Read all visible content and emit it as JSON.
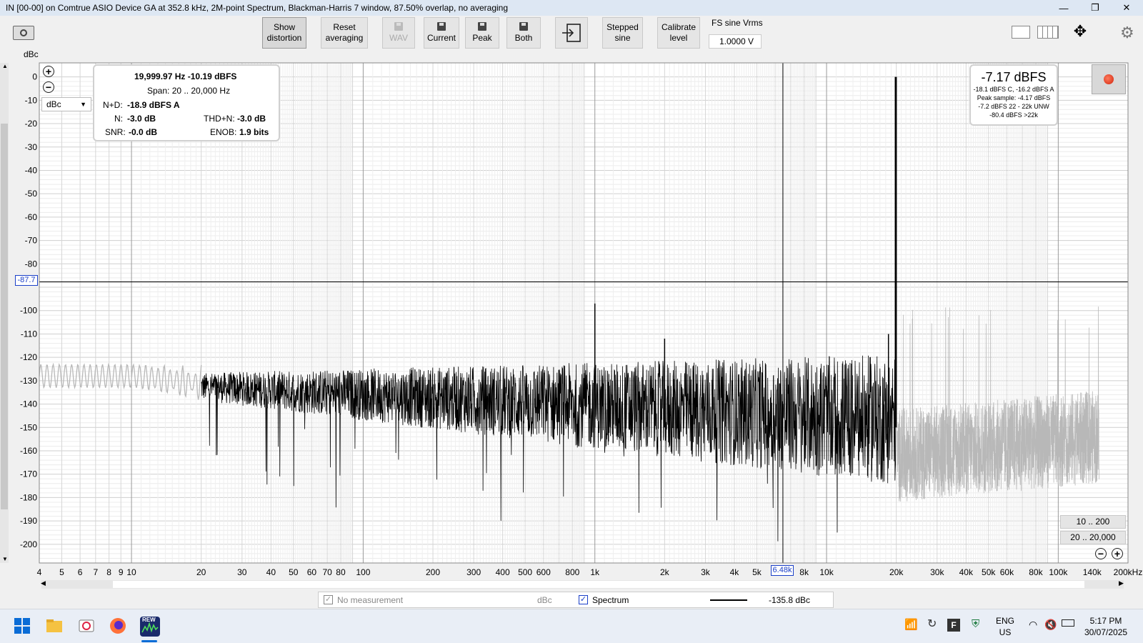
{
  "window": {
    "title": "IN [00-00] on Comtrue ASIO Device GA at 352.8 kHz, 2M-point Spectrum, Blackman-Harris 7 window, 87.50% overlap, no averaging",
    "minimize": "—",
    "maximize": "❐",
    "close": "✕"
  },
  "toolbar": {
    "show_distortion": [
      "Show",
      "distortion"
    ],
    "reset_averaging": [
      "Reset",
      "averaging"
    ],
    "wav": "WAV",
    "current": "Current",
    "peak": "Peak",
    "both": "Both",
    "stepped_sine": [
      "Stepped",
      "sine"
    ],
    "calibrate_level": [
      "Calibrate",
      "level"
    ],
    "fs_sine_label": "FS sine Vrms",
    "fs_sine_value": "1.0000 V"
  },
  "info_box": {
    "freq_level": "19,999.97 Hz  -10.19 dBFS",
    "span": "Span: 20 .. 20,000 Hz",
    "nd_label": "N+D:",
    "nd_value": "-18.9 dBFS A",
    "n_label": "N:",
    "n_value": "-3.0 dB",
    "thdn_label": "THD+N:",
    "thdn_value": "-3.0 dB",
    "snr_label": "SNR:",
    "snr_value": "-0.0 dB",
    "enob_label": "ENOB:",
    "enob_value": "1.9 bits"
  },
  "level_box": {
    "main": "-7.17 dBFS",
    "lines": [
      "-18.1 dBFS C, -16.2 dBFS A",
      "Peak sample: -4.17 dBFS",
      "-7.2 dBFS 22 - 22k UNW",
      "-80.4 dBFS >22k"
    ]
  },
  "plot": {
    "y_unit": "dBc",
    "unit_select": "dBc",
    "cursor_y": "-87.7",
    "cursor_x": "6.48k",
    "range_btn_1": "10 .. 200",
    "range_btn_2": "20 .. 20,000"
  },
  "chart_data": {
    "type": "line",
    "ylabel": "dBc",
    "xlabel": "",
    "x_scale": "log",
    "xlim_hz": [
      4,
      200000
    ],
    "ylim": [
      -208,
      6
    ],
    "y_ticks": [
      "0",
      "-10",
      "-20",
      "-30",
      "-40",
      "-50",
      "-60",
      "-70",
      "-80",
      "-90",
      "-100",
      "-110",
      "-120",
      "-130",
      "-140",
      "-150",
      "-160",
      "-170",
      "-180",
      "-190",
      "-200"
    ],
    "x_ticks": [
      {
        "hz": 4,
        "label": "4"
      },
      {
        "hz": 5,
        "label": "5"
      },
      {
        "hz": 6,
        "label": "6"
      },
      {
        "hz": 7,
        "label": "7"
      },
      {
        "hz": 8,
        "label": "8"
      },
      {
        "hz": 9,
        "label": "9"
      },
      {
        "hz": 10,
        "label": "10"
      },
      {
        "hz": 20,
        "label": "20"
      },
      {
        "hz": 30,
        "label": "30"
      },
      {
        "hz": 40,
        "label": "40"
      },
      {
        "hz": 50,
        "label": "50"
      },
      {
        "hz": 60,
        "label": "60"
      },
      {
        "hz": 70,
        "label": "70"
      },
      {
        "hz": 80,
        "label": "80"
      },
      {
        "hz": 100,
        "label": "100"
      },
      {
        "hz": 200,
        "label": "200"
      },
      {
        "hz": 300,
        "label": "300"
      },
      {
        "hz": 400,
        "label": "400"
      },
      {
        "hz": 500,
        "label": "500"
      },
      {
        "hz": 600,
        "label": "600"
      },
      {
        "hz": 800,
        "label": "800"
      },
      {
        "hz": 1000,
        "label": "1k"
      },
      {
        "hz": 2000,
        "label": "2k"
      },
      {
        "hz": 3000,
        "label": "3k"
      },
      {
        "hz": 4000,
        "label": "4k"
      },
      {
        "hz": 5000,
        "label": "5k"
      },
      {
        "hz": 8000,
        "label": "8k"
      },
      {
        "hz": 10000,
        "label": "10k"
      },
      {
        "hz": 20000,
        "label": "20k"
      },
      {
        "hz": 30000,
        "label": "30k"
      },
      {
        "hz": 40000,
        "label": "40k"
      },
      {
        "hz": 50000,
        "label": "50k"
      },
      {
        "hz": 60000,
        "label": "60k"
      },
      {
        "hz": 80000,
        "label": "80k"
      },
      {
        "hz": 100000,
        "label": "100k"
      },
      {
        "hz": 140000,
        "label": "140k"
      },
      {
        "hz": 200000,
        "label": "200kHz"
      }
    ],
    "cursor": {
      "x_hz": 6480,
      "y_db": -87.7
    },
    "series": [
      {
        "name": "Spectrum",
        "color": "#000000",
        "noise_floor_db": -140,
        "peaks": [
          {
            "hz": 1000,
            "db": -97
          },
          {
            "hz": 2000,
            "db": -112
          },
          {
            "hz": 19800,
            "db": 0
          },
          {
            "hz": 20000,
            "db": 0
          },
          {
            "hz": 18500,
            "db": -110
          }
        ]
      }
    ]
  },
  "legend": {
    "no_measurement": "No measurement",
    "unit": "dBc",
    "spectrum": "Spectrum",
    "value": "-135.8 dBc"
  },
  "taskbar": {
    "lang1": "ENG",
    "lang2": "US",
    "time": "5:17 PM",
    "date": "30/07/2025",
    "rew_label": "REW"
  }
}
